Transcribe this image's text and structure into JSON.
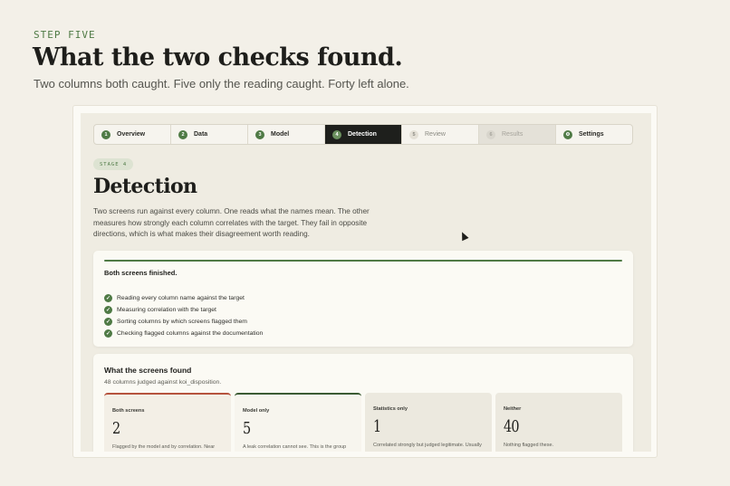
{
  "page": {
    "eyebrow": "STEP FIVE",
    "headline": "What the two checks found.",
    "subline": "Two columns both caught. Five only the reading caught. Forty left alone."
  },
  "stepper": {
    "steps": [
      {
        "num": "1",
        "label": "Overview",
        "state": "done"
      },
      {
        "num": "2",
        "label": "Data",
        "state": "done"
      },
      {
        "num": "3",
        "label": "Model",
        "state": "done"
      },
      {
        "num": "4",
        "label": "Detection",
        "state": "active"
      },
      {
        "num": "5",
        "label": "Review",
        "state": "upcoming"
      },
      {
        "num": "6",
        "label": "Results",
        "state": "disabled"
      },
      {
        "num": "⚙",
        "label": "Settings",
        "state": "done"
      }
    ]
  },
  "stage": {
    "badge": "STAGE 4",
    "title": "Detection",
    "description": "Two screens run against every column. One reads what the names mean. The other measures how strongly each column correlates with the target. They fail in opposite directions, which is what makes their disagreement worth reading."
  },
  "progress": {
    "title": "Both screens finished.",
    "fraction": 1.0,
    "items": [
      "Reading every column name against the target",
      "Measuring correlation with the target",
      "Sorting columns by which screens flagged them",
      "Checking flagged columns against the documentation"
    ]
  },
  "found": {
    "title": "What the screens found",
    "subtitle": "48 columns judged against koi_disposition.",
    "tiles": [
      {
        "label": "Both screens",
        "count": "2",
        "desc": "Flagged by the model and by correlation. Near certain.",
        "accent": "#b5533e"
      },
      {
        "label": "Model only",
        "count": "5",
        "desc": "A leak correlation cannot see. This is the group statistics would have missed, and the",
        "accent": "#3b5b34"
      },
      {
        "label": "Statistics only",
        "count": "1",
        "desc": "Correlated strongly but judged legitimate. Usually a real predictor.",
        "accent": ""
      },
      {
        "label": "Neither",
        "count": "40",
        "desc": "Nothing flagged these.",
        "accent": ""
      }
    ]
  },
  "colors": {
    "accent_green": "#4f7a45",
    "accent_red": "#b5533e",
    "active_step_bg": "#1e1f1c",
    "page_bg": "#f3f0e8"
  }
}
